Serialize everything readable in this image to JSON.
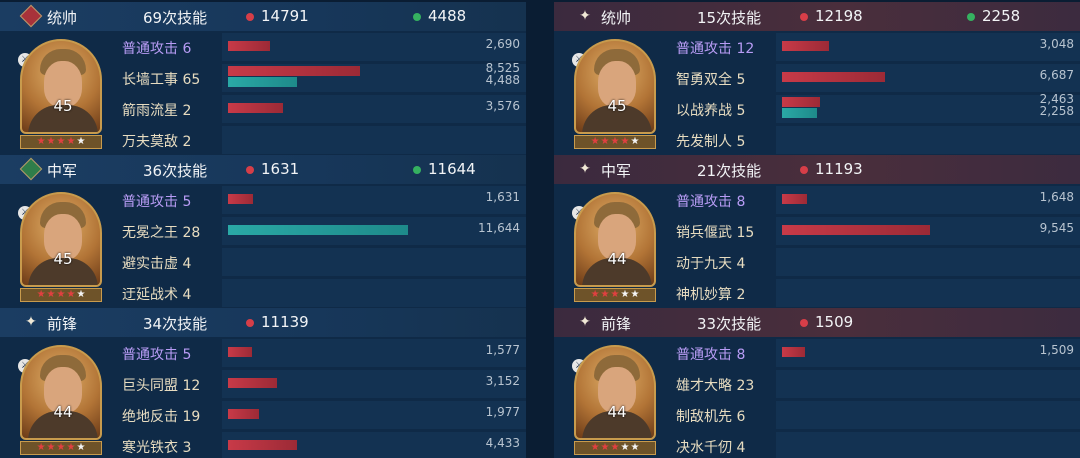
{
  "colors": {
    "damage": "#d63e48",
    "heal": "#35b160",
    "red_bar": "#c83a48",
    "teal_bar": "#2aa9a6",
    "basic_skill_text": "#b89cf5",
    "skill_text": "#e7dcc0"
  },
  "left": [
    {
      "role": "统帅",
      "badge": "diamond-badge-icon",
      "skills_total": "69次技能",
      "damage": "14791",
      "heal": "4488",
      "hero": {
        "level": "45",
        "troop_icon": "cavalry-icon",
        "stars": [
          "red",
          "red",
          "red",
          "red",
          "white"
        ]
      },
      "skills": [
        {
          "name": "普通攻击 6",
          "basic": true,
          "damage": 2690,
          "heal": 0,
          "damage_label": "2,690",
          "heal_label": ""
        },
        {
          "name": "长墙工事 65",
          "basic": false,
          "damage": 8525,
          "heal": 4488,
          "damage_label": "8,525",
          "heal_label": "4,488"
        },
        {
          "name": "箭雨流星 2",
          "basic": false,
          "damage": 3576,
          "heal": 0,
          "damage_label": "3,576",
          "heal_label": ""
        },
        {
          "name": "万夫莫敌 2",
          "basic": false,
          "damage": 0,
          "heal": 0,
          "damage_label": "",
          "heal_label": ""
        }
      ]
    },
    {
      "role": "中军",
      "badge": "diamond-badge-icon",
      "skills_total": "36次技能",
      "damage": "1631",
      "heal": "11644",
      "hero": {
        "level": "45",
        "troop_icon": "shield-infantry-icon",
        "stars": [
          "red",
          "red",
          "red",
          "red",
          "white"
        ]
      },
      "skills": [
        {
          "name": "普通攻击 5",
          "basic": true,
          "damage": 1631,
          "heal": 0,
          "damage_label": "1,631",
          "heal_label": ""
        },
        {
          "name": "无冕之王 28",
          "basic": false,
          "damage": 0,
          "heal": 11644,
          "damage_label": "",
          "heal_label": "11,644"
        },
        {
          "name": "避实击虚 4",
          "basic": false,
          "damage": 0,
          "heal": 0,
          "damage_label": "",
          "heal_label": ""
        },
        {
          "name": "迂延战术 4",
          "basic": false,
          "damage": 0,
          "heal": 0,
          "damage_label": "",
          "heal_label": ""
        }
      ]
    },
    {
      "role": "前锋",
      "badge": "sparkle-badge-icon",
      "skills_total": "34次技能",
      "damage": "11139",
      "heal": "",
      "hero": {
        "level": "44",
        "troop_icon": "archer-icon",
        "stars": [
          "red",
          "red",
          "red",
          "red",
          "white"
        ]
      },
      "skills": [
        {
          "name": "普通攻击 5",
          "basic": true,
          "damage": 1577,
          "heal": 0,
          "damage_label": "1,577",
          "heal_label": ""
        },
        {
          "name": "巨头同盟 12",
          "basic": false,
          "damage": 3152,
          "heal": 0,
          "damage_label": "3,152",
          "heal_label": ""
        },
        {
          "name": "绝地反击 19",
          "basic": false,
          "damage": 1977,
          "heal": 0,
          "damage_label": "1,977",
          "heal_label": ""
        },
        {
          "name": "寒光铁衣 3",
          "basic": false,
          "damage": 4433,
          "heal": 0,
          "damage_label": "4,433",
          "heal_label": ""
        }
      ]
    }
  ],
  "right": [
    {
      "role": "统帅",
      "badge": "sparkle-badge-icon",
      "skills_total": "15次技能",
      "damage": "12198",
      "heal": "2258",
      "hero": {
        "level": "45",
        "troop_icon": "cavalry-icon",
        "stars": [
          "red",
          "red",
          "red",
          "red",
          "white"
        ]
      },
      "skills": [
        {
          "name": "普通攻击 12",
          "basic": true,
          "damage": 3048,
          "heal": 0,
          "damage_label": "3,048",
          "heal_label": ""
        },
        {
          "name": "智勇双全 5",
          "basic": false,
          "damage": 6687,
          "heal": 0,
          "damage_label": "6,687",
          "heal_label": ""
        },
        {
          "name": "以战养战 5",
          "basic": false,
          "damage": 2463,
          "heal": 2258,
          "damage_label": "2,463",
          "heal_label": "2,258"
        },
        {
          "name": "先发制人 5",
          "basic": false,
          "damage": 0,
          "heal": 0,
          "damage_label": "",
          "heal_label": ""
        }
      ]
    },
    {
      "role": "中军",
      "badge": "sparkle-badge-icon",
      "skills_total": "21次技能",
      "damage": "11193",
      "heal": "",
      "hero": {
        "level": "44",
        "troop_icon": "spear-icon",
        "stars": [
          "red",
          "red",
          "red",
          "white",
          "white"
        ]
      },
      "skills": [
        {
          "name": "普通攻击 8",
          "basic": true,
          "damage": 1648,
          "heal": 0,
          "damage_label": "1,648",
          "heal_label": ""
        },
        {
          "name": "销兵偃武 15",
          "basic": false,
          "damage": 9545,
          "heal": 0,
          "damage_label": "9,545",
          "heal_label": ""
        },
        {
          "name": "动于九天 4",
          "basic": false,
          "damage": 0,
          "heal": 0,
          "damage_label": "",
          "heal_label": ""
        },
        {
          "name": "神机妙算 2",
          "basic": false,
          "damage": 0,
          "heal": 0,
          "damage_label": "",
          "heal_label": ""
        }
      ]
    },
    {
      "role": "前锋",
      "badge": "sparkle-badge-icon",
      "skills_total": "33次技能",
      "damage": "1509",
      "heal": "",
      "hero": {
        "level": "44",
        "troop_icon": "cavalry-icon",
        "stars": [
          "red",
          "red",
          "red",
          "white",
          "white"
        ]
      },
      "skills": [
        {
          "name": "普通攻击 8",
          "basic": true,
          "damage": 1509,
          "heal": 0,
          "damage_label": "1,509",
          "heal_label": ""
        },
        {
          "name": "雄才大略 23",
          "basic": false,
          "damage": 0,
          "heal": 0,
          "damage_label": "",
          "heal_label": ""
        },
        {
          "name": "制敌机先 6",
          "basic": false,
          "damage": 0,
          "heal": 0,
          "damage_label": "",
          "heal_label": ""
        },
        {
          "name": "决水千仞 4",
          "basic": false,
          "damage": 0,
          "heal": 0,
          "damage_label": "",
          "heal_label": ""
        }
      ]
    }
  ]
}
